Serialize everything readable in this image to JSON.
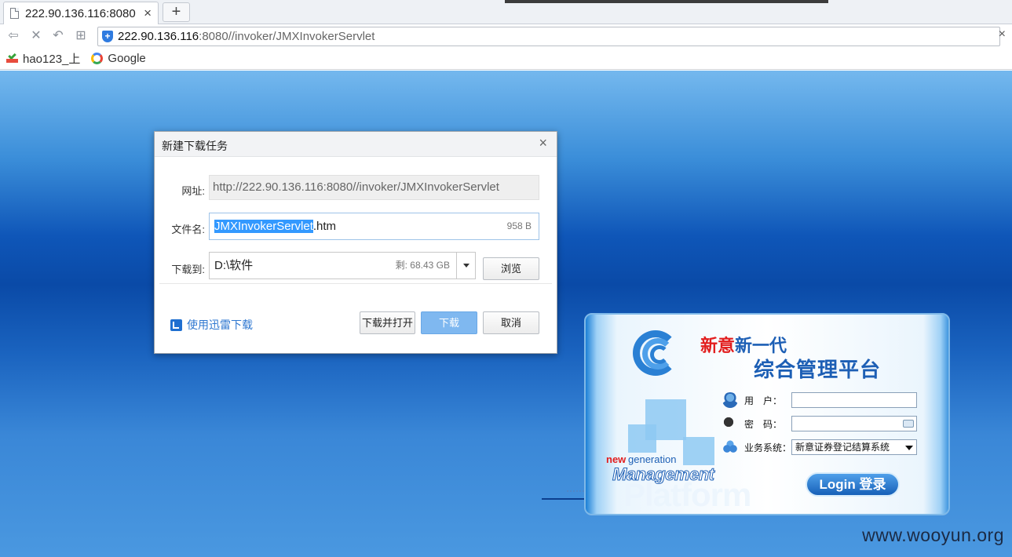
{
  "browser": {
    "tab_title": "222.90.136.116:8080",
    "new_tab": "+",
    "address_host": "222.90.136.116",
    "address_path": ":8080//invoker/JMXInvokerServlet",
    "bookmarks": [
      "hao123_上",
      "Google"
    ]
  },
  "dialog": {
    "title": "新建下载任务",
    "close": "×",
    "url_label": "网址:",
    "url_value": "http://222.90.136.116:8080//invoker/JMXInvokerServlet",
    "filename_label": "文件名:",
    "filename_selected": "JMXInvokerServlet",
    "filename_ext": ".htm",
    "filesize": "958 B",
    "saveto_label": "下载到:",
    "saveto_path": "D:\\软件",
    "free_space": "剩: 68.43 GB",
    "browse_button": "浏览",
    "thunder_link": "使用迅雷下载",
    "download_open_button": "下载并打开",
    "download_button": "下载",
    "cancel_button": "取消"
  },
  "login": {
    "title_red": "新意",
    "title_blue": "新一代",
    "subtitle": "综合管理平台",
    "user_label": "用　户：",
    "password_label": "密　码：",
    "system_label": "业务系统：",
    "system_value": "新意证券登记结算系统",
    "ng_new": "new",
    "ng_generation": "generation",
    "ng_management": "Management",
    "ng_platform": "Platform",
    "login_button": "Login 登录"
  },
  "watermark": "www.wooyun.org"
}
